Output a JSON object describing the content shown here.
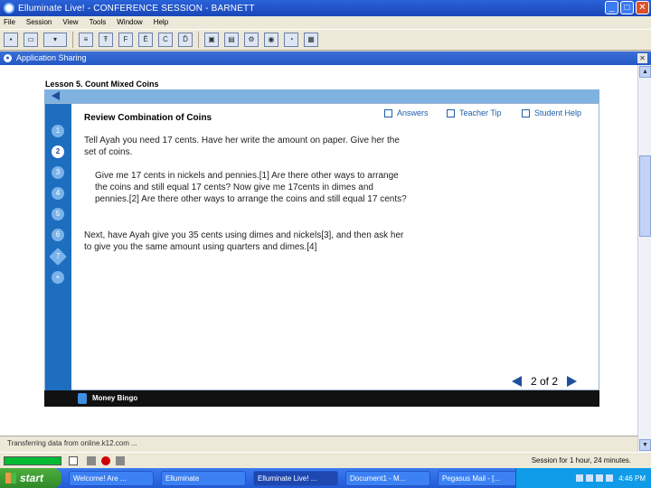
{
  "window": {
    "title": "Elluminate Live! - CONFERENCE SESSION - BARNETT",
    "min_btn": "_",
    "max_btn": "□",
    "close_btn": "✕"
  },
  "menu": [
    "File",
    "Session",
    "View",
    "Tools",
    "Window",
    "Help"
  ],
  "toolbar_buttons": [
    "save-icon",
    "print-icon",
    "layout-icon",
    "list-icon",
    "text-icon",
    "font-icon",
    "format-icon",
    "align-icon",
    "link-icon",
    "screen-icon",
    "folder-icon",
    "gear-icon",
    "globe-icon",
    "clock-icon",
    "board-icon"
  ],
  "panel": {
    "title": "Application Sharing",
    "close": "✕"
  },
  "lesson": {
    "title": "Lesson 5. Count Mixed Coins",
    "review_title": "Review Combination of Coins",
    "options": {
      "answers": "Answers",
      "teacher_tip": "Teacher Tip",
      "student_help": "Student Help"
    },
    "steps": [
      "1",
      "2",
      "3",
      "4",
      "5",
      "6",
      "7",
      "+"
    ],
    "active_step": "2",
    "para1": "Tell Ayah you need 17 cents. Have her write the amount on paper. Give her the set of coins.",
    "para2": "Give me 17 cents in nickels and pennies.[1] Are there other ways to arrange the coins and still equal 17 cents? Now give me 17cents in dimes and pennies.[2] Are there other ways to arrange the coins and still equal 17 cents?",
    "para3": "Next, have Ayah give you 35 cents using dimes and nickels[3], and then ask her to give you the same amount using quarters and dimes.[4]",
    "page": "2 of 2",
    "bottom_label": "Money Bingo"
  },
  "status": {
    "text": "Transferring data from online.k12.com ...",
    "session_time": "Session for 1 hour, 24 minutes."
  },
  "taskbar": {
    "start": "start",
    "tasks": [
      "Welcome! Are ...",
      "Elluminate",
      "Elluminate Live! ...",
      "Document1 - M...",
      "Pegasus Mail - [..."
    ],
    "active_task": "Elluminate Live! ...",
    "clock": "4:46 PM"
  },
  "colors": {
    "title_bar": "#2458c4",
    "step_column": "#1e6ec0",
    "link_blue": "#2060a8",
    "top_strip": "#7fb2e0",
    "start_green": "#3a9a32"
  }
}
